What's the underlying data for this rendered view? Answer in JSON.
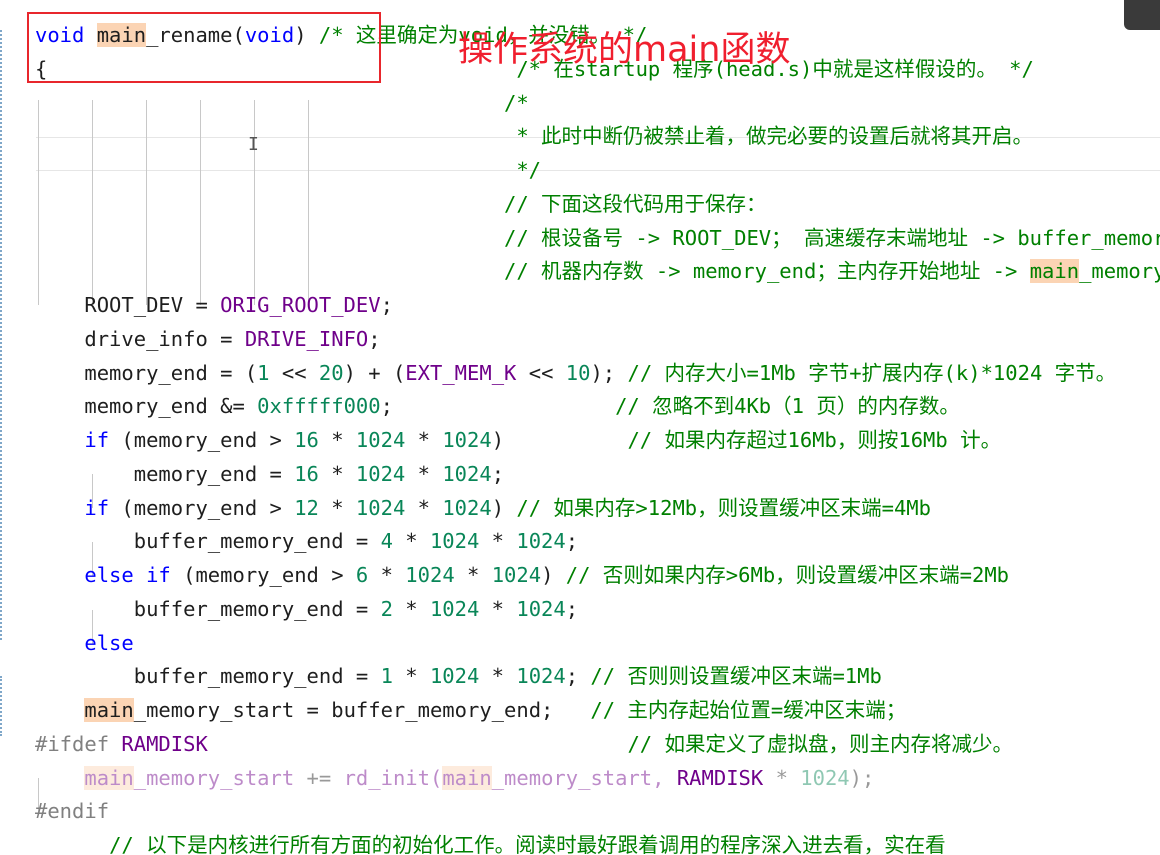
{
  "annotation": {
    "text": "操作系统的main函数"
  },
  "editor": {
    "cursor_glyph": "I",
    "lines": [
      [
        {
          "t": "void",
          "c": "kw"
        },
        {
          "t": " "
        },
        {
          "t": "main",
          "c": "hl"
        },
        {
          "t": "_rename("
        },
        {
          "t": "void",
          "c": "kw"
        },
        {
          "t": ") "
        },
        {
          "t": "/* 这里确定为void，并没错。 */",
          "c": "cm"
        }
      ],
      [
        {
          "t": "{"
        },
        {
          "t": "                                      "
        },
        {
          "t": "/* 在startup 程序(head.s)中就是这样假设的。 */",
          "c": "cm"
        }
      ],
      [
        {
          "t": "                                      "
        },
        {
          "t": "/*",
          "c": "cm"
        }
      ],
      [
        {
          "t": "                                       "
        },
        {
          "t": "* 此时中断仍被禁止着，做完必要的设置后就将其开启。",
          "c": "cm"
        }
      ],
      [
        {
          "t": "                                       "
        },
        {
          "t": "*/",
          "c": "cm"
        }
      ],
      [
        {
          "t": "                                      "
        },
        {
          "t": "// 下面这段代码用于保存：",
          "c": "cm"
        }
      ],
      [
        {
          "t": "                                      "
        },
        {
          "t": "// 根设备号 -> ROOT_DEV； 高速缓存末端地址 -> buffer_memory_end；",
          "c": "cm"
        }
      ],
      [
        {
          "t": "                                      "
        },
        {
          "t": "// 机器内存数 -> memory_end；主内存开始地址 -> ",
          "c": "cm"
        },
        {
          "t": "main",
          "c": "cm hl"
        },
        {
          "t": "_memory_start；",
          "c": "cm"
        }
      ],
      [
        {
          "t": "    ROOT_DEV = "
        },
        {
          "t": "ORIG_ROOT_DEV",
          "c": "mac"
        },
        {
          "t": ";"
        }
      ],
      [
        {
          "t": "    drive_info = "
        },
        {
          "t": "DRIVE_INFO",
          "c": "mac"
        },
        {
          "t": ";"
        }
      ],
      [
        {
          "t": "    memory_end = ("
        },
        {
          "t": "1",
          "c": "num"
        },
        {
          "t": " << "
        },
        {
          "t": "20",
          "c": "num"
        },
        {
          "t": ") + ("
        },
        {
          "t": "EXT_MEM_K",
          "c": "mac"
        },
        {
          "t": " << "
        },
        {
          "t": "10",
          "c": "num"
        },
        {
          "t": "); "
        },
        {
          "t": "// 内存大小=1Mb 字节+扩展内存(k)*1024 字节。",
          "c": "cm"
        }
      ],
      [
        {
          "t": "    memory_end &= "
        },
        {
          "t": "0xfffff000",
          "c": "num"
        },
        {
          "t": ";                  "
        },
        {
          "t": "// 忽略不到4Kb（1 页）的内存数。",
          "c": "cm"
        }
      ],
      [
        {
          "t": "    "
        },
        {
          "t": "if",
          "c": "kw"
        },
        {
          "t": " (memory_end > "
        },
        {
          "t": "16",
          "c": "num"
        },
        {
          "t": " * "
        },
        {
          "t": "1024",
          "c": "num"
        },
        {
          "t": " * "
        },
        {
          "t": "1024",
          "c": "num"
        },
        {
          "t": ")          "
        },
        {
          "t": "// 如果内存超过16Mb，则按16Mb 计。",
          "c": "cm"
        }
      ],
      [
        {
          "t": "        memory_end = "
        },
        {
          "t": "16",
          "c": "num"
        },
        {
          "t": " * "
        },
        {
          "t": "1024",
          "c": "num"
        },
        {
          "t": " * "
        },
        {
          "t": "1024",
          "c": "num"
        },
        {
          "t": ";"
        }
      ],
      [
        {
          "t": "    "
        },
        {
          "t": "if",
          "c": "kw"
        },
        {
          "t": " (memory_end > "
        },
        {
          "t": "12",
          "c": "num"
        },
        {
          "t": " * "
        },
        {
          "t": "1024",
          "c": "num"
        },
        {
          "t": " * "
        },
        {
          "t": "1024",
          "c": "num"
        },
        {
          "t": ") "
        },
        {
          "t": "// 如果内存>12Mb，则设置缓冲区末端=4Mb",
          "c": "cm"
        }
      ],
      [
        {
          "t": "        buffer_memory_end = "
        },
        {
          "t": "4",
          "c": "num"
        },
        {
          "t": " * "
        },
        {
          "t": "1024",
          "c": "num"
        },
        {
          "t": " * "
        },
        {
          "t": "1024",
          "c": "num"
        },
        {
          "t": ";"
        }
      ],
      [
        {
          "t": "    "
        },
        {
          "t": "else if",
          "c": "kw"
        },
        {
          "t": " (memory_end > "
        },
        {
          "t": "6",
          "c": "num"
        },
        {
          "t": " * "
        },
        {
          "t": "1024",
          "c": "num"
        },
        {
          "t": " * "
        },
        {
          "t": "1024",
          "c": "num"
        },
        {
          "t": ") "
        },
        {
          "t": "// 否则如果内存>6Mb，则设置缓冲区末端=2Mb",
          "c": "cm"
        }
      ],
      [
        {
          "t": "        buffer_memory_end = "
        },
        {
          "t": "2",
          "c": "num"
        },
        {
          "t": " * "
        },
        {
          "t": "1024",
          "c": "num"
        },
        {
          "t": " * "
        },
        {
          "t": "1024",
          "c": "num"
        },
        {
          "t": ";"
        }
      ],
      [
        {
          "t": "    "
        },
        {
          "t": "else",
          "c": "kw"
        }
      ],
      [
        {
          "t": "        buffer_memory_end = "
        },
        {
          "t": "1",
          "c": "num"
        },
        {
          "t": " * "
        },
        {
          "t": "1024",
          "c": "num"
        },
        {
          "t": " * "
        },
        {
          "t": "1024",
          "c": "num"
        },
        {
          "t": "; "
        },
        {
          "t": "// 否则则设置缓冲区末端=1Mb",
          "c": "cm"
        }
      ],
      [
        {
          "t": "    "
        },
        {
          "t": "main",
          "c": "hl"
        },
        {
          "t": "_memory_start = buffer_memory_end;   "
        },
        {
          "t": "// 主内存起始位置=缓冲区末端；",
          "c": "cm"
        }
      ],
      [
        {
          "t": "#ifdef",
          "c": "pp"
        },
        {
          "t": " "
        },
        {
          "t": "RAMDISK",
          "c": "mac"
        },
        {
          "t": "                                  "
        },
        {
          "t": "// 如果定义了虚拟盘，则主内存将减少。",
          "c": "cm"
        }
      ],
      [
        {
          "t": "    "
        },
        {
          "t": "main",
          "c": "mac dim hl"
        },
        {
          "t": "_memory_start",
          "c": "mac dim"
        },
        {
          "t": " += ",
          "c": "id dim"
        },
        {
          "t": "rd_init(",
          "c": "mac dim"
        },
        {
          "t": "main",
          "c": "mac dim hl"
        },
        {
          "t": "_memory_start, ",
          "c": "mac dim"
        },
        {
          "t": "RAMDISK",
          "c": "mac"
        },
        {
          "t": " * ",
          "c": "id dim"
        },
        {
          "t": "1024",
          "c": "num dim"
        },
        {
          "t": ");",
          "c": "id dim"
        }
      ],
      [
        {
          "t": "#endif",
          "c": "pp"
        }
      ],
      [
        {
          "t": "      "
        },
        {
          "t": "// 以下是内核进行所有方面的初始化工作。阅读时最好跟着调用的程序深入进去看，实在看",
          "c": "cm"
        }
      ]
    ]
  }
}
